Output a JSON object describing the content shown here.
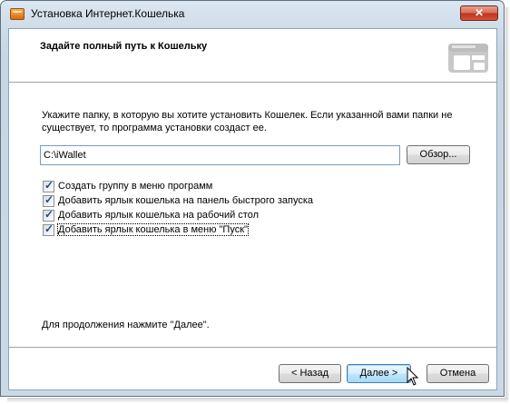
{
  "window": {
    "title": "Установка Интернет.Кошелька"
  },
  "titlebar": {
    "close_glyph": "✕"
  },
  "header": {
    "title": "Задайте полный путь к Кошельку",
    "icon": "wallet-icon"
  },
  "main": {
    "description": "Укажите папку, в которую вы хотите установить Кошелек. Если указанной вами папки не существует, то программа установки создаст ее.",
    "path_value": "C:\\iWallet",
    "browse_label": "Обзор...",
    "checkboxes": [
      {
        "label": "Создать группу в меню программ",
        "checked": true
      },
      {
        "label": "Добавить ярлык кошелька на панель быстрого запуска",
        "checked": true
      },
      {
        "label": "Добавить ярлык кошелька на рабочий стол",
        "checked": true
      },
      {
        "label": "Добавить ярлык кошелька в меню \"Пуск\"",
        "checked": true
      }
    ],
    "hint": "Для продолжения нажмите \"Далее\"."
  },
  "footer": {
    "back_label": "< Назад",
    "next_label": "Далее >",
    "cancel_label": "Отмена"
  },
  "colors": {
    "title_gradient_top": "#dbe7f3",
    "close_button": "#c0341c",
    "default_button_border": "#3c7fb1"
  }
}
